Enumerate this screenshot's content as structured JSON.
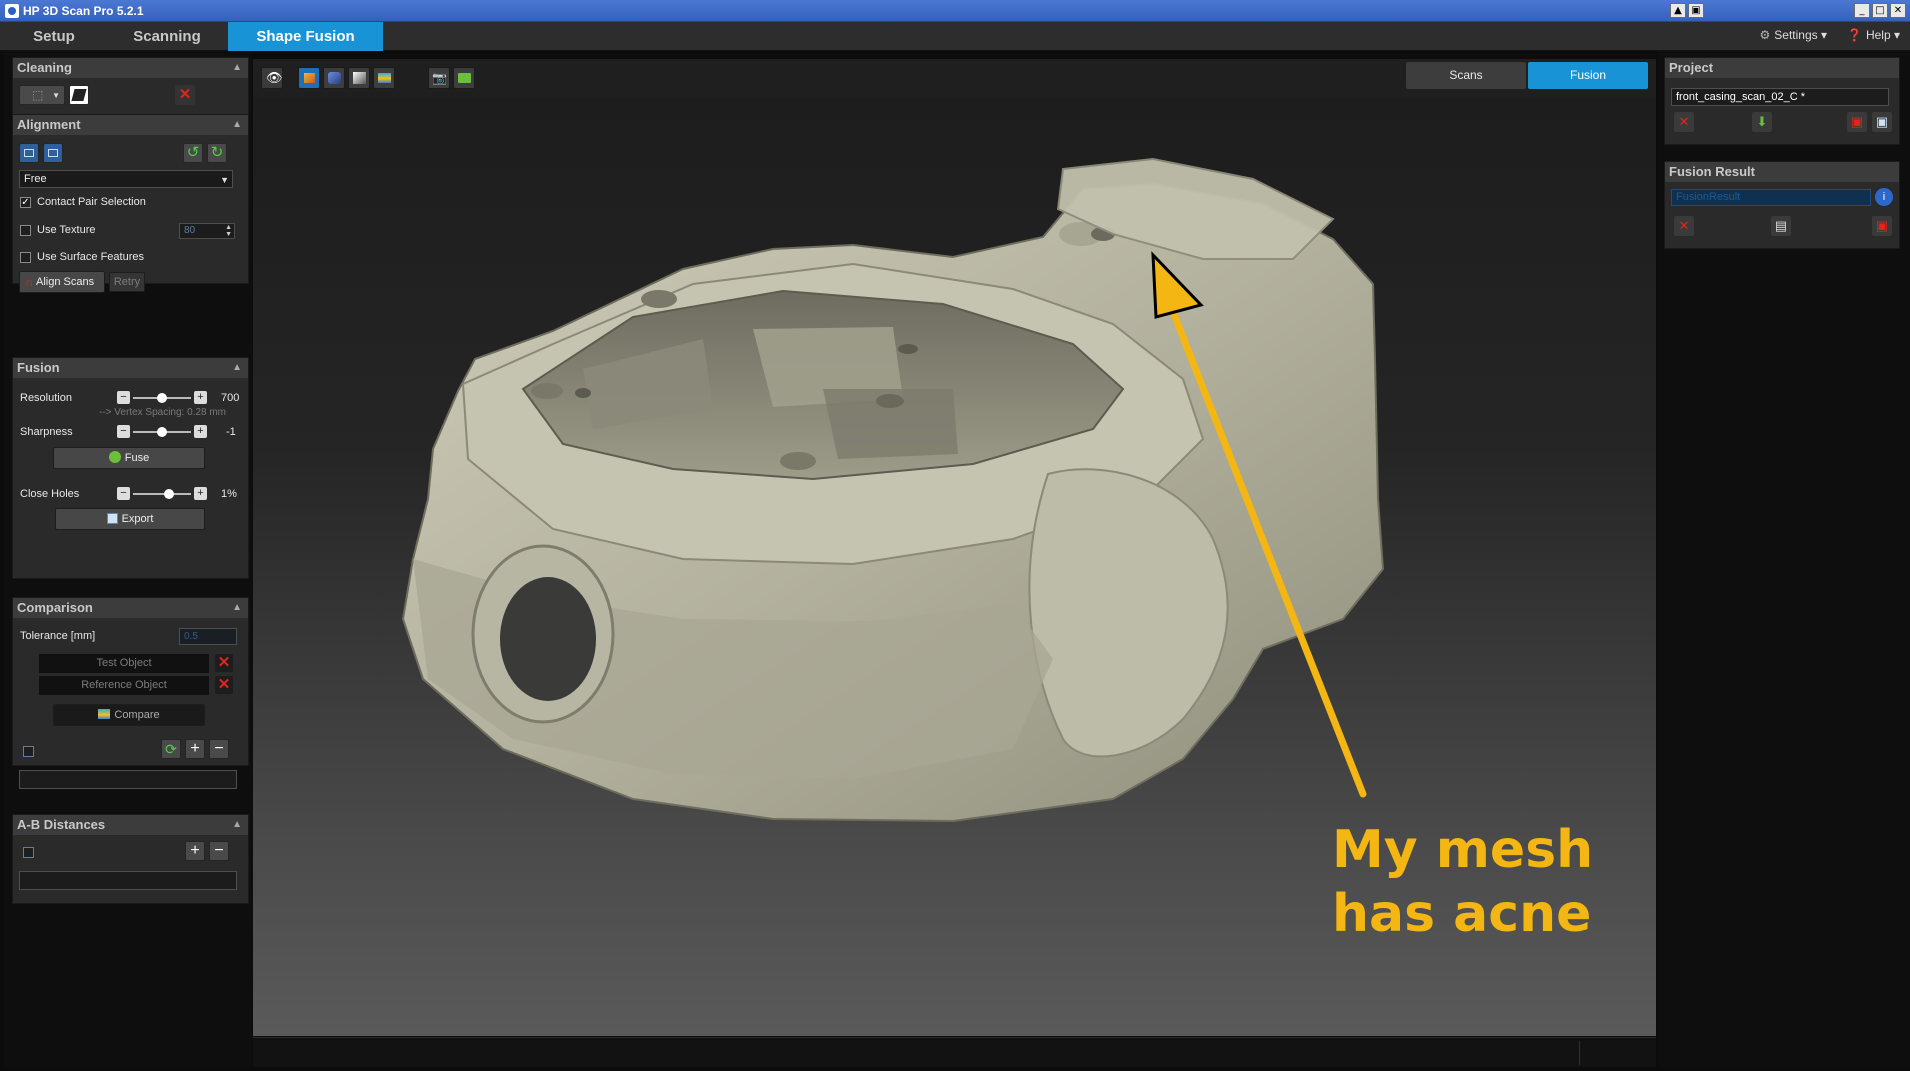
{
  "window": {
    "title": "HP 3D Scan Pro 5.2.1",
    "controls": [
      "▲",
      "▣",
      "_",
      "□",
      "✕"
    ]
  },
  "main_tabs": [
    {
      "label": "Setup",
      "active": false
    },
    {
      "label": "Scanning",
      "active": false
    },
    {
      "label": "Shape Fusion",
      "active": true
    }
  ],
  "topbar": {
    "settings_label": "Settings ▾",
    "help_label": "Help ▾"
  },
  "cleaning": {
    "title": "Cleaning"
  },
  "alignment": {
    "title": "Alignment",
    "mode_value": "Free",
    "contact_pair_label": "Contact Pair Selection",
    "contact_pair_checked": true,
    "use_texture_label": "Use Texture",
    "use_texture_checked": false,
    "texture_value": "80",
    "use_surface_label": "Use Surface Features",
    "use_surface_checked": false,
    "align_label": "Align Scans",
    "retry_label": "Retry"
  },
  "fusion": {
    "title": "Fusion",
    "resolution_label": "Resolution",
    "resolution_value": "700",
    "resolution_level": 0.5,
    "vertex_spacing": "--> Vertex Spacing: 0.28 mm",
    "sharpness_label": "Sharpness",
    "sharpness_value": "-1",
    "sharpness_level": 0.5,
    "fuse_label": "Fuse",
    "close_holes_label": "Close Holes",
    "close_holes_value": "1%",
    "close_holes_level": 0.65,
    "export_label": "Export"
  },
  "comparison": {
    "title": "Comparison",
    "tolerance_label": "Tolerance [mm]",
    "tolerance_value": "0.5",
    "test_object": "Test Object",
    "reference_object": "Reference Object",
    "compare_label": "Compare"
  },
  "ab_distances": {
    "title": "A-B Distances"
  },
  "viewport": {
    "view_tabs": [
      {
        "label": "Scans",
        "active": false
      },
      {
        "label": "Fusion",
        "active": true
      }
    ],
    "annotation_line1": "My mesh",
    "annotation_line2": "has acne"
  },
  "project": {
    "title": "Project",
    "name": "front_casing_scan_02_C *"
  },
  "fusion_result": {
    "title": "Fusion Result",
    "item": "FusionResult"
  },
  "colors": {
    "accent": "#1793d6",
    "annotation": "#f4b613",
    "mesh": "#b9b8a4"
  }
}
